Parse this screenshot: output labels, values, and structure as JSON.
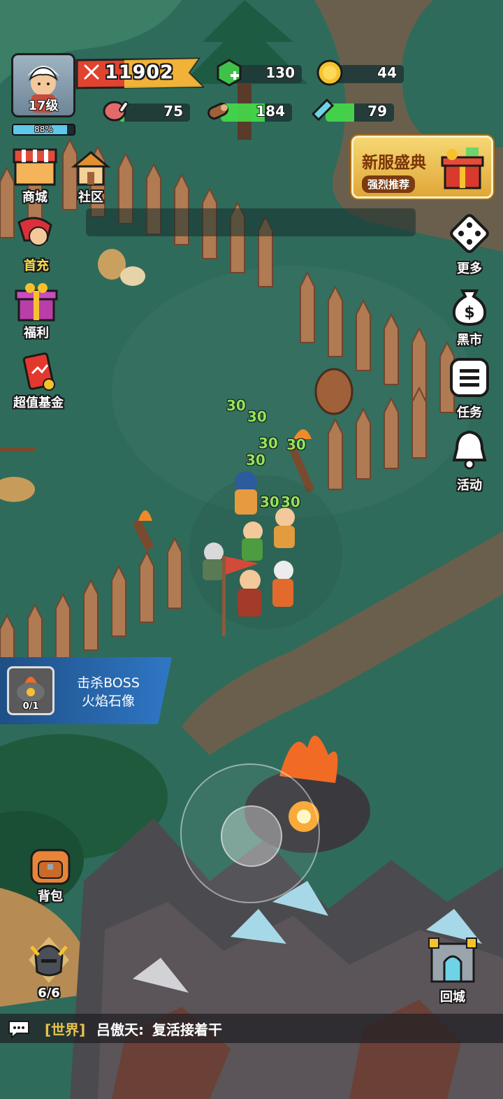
{
  "player": {
    "level": "17级",
    "xp_percent_text": "88%",
    "xp_fraction": 0.88,
    "power": "11902"
  },
  "resources": {
    "gems": "130",
    "gold": "44",
    "meat": {
      "value": "75",
      "fill": 0.08
    },
    "wood": {
      "value": "184",
      "fill": 0.62
    },
    "crystal": {
      "value": "79",
      "fill": 0.42
    }
  },
  "promo": {
    "title": "新服盛典",
    "subtitle": "强烈推荐"
  },
  "left_menu": [
    "商城",
    "社区",
    "首充",
    "福利",
    "超值基金"
  ],
  "right_menu": [
    "更多",
    "黑市",
    "任务",
    "活动"
  ],
  "quest": {
    "count": "0/1",
    "line1": "击杀BOSS",
    "line2": "火焰石像"
  },
  "damage_numbers": [
    "30",
    "30",
    "30",
    "30",
    "30",
    "30",
    "30"
  ],
  "bottom": {
    "backpack": "背包",
    "heroes": "6/6",
    "return_city": "回城"
  },
  "chat": {
    "channel": "[世界]",
    "name": "吕傲天:",
    "message": "复活接着干"
  }
}
